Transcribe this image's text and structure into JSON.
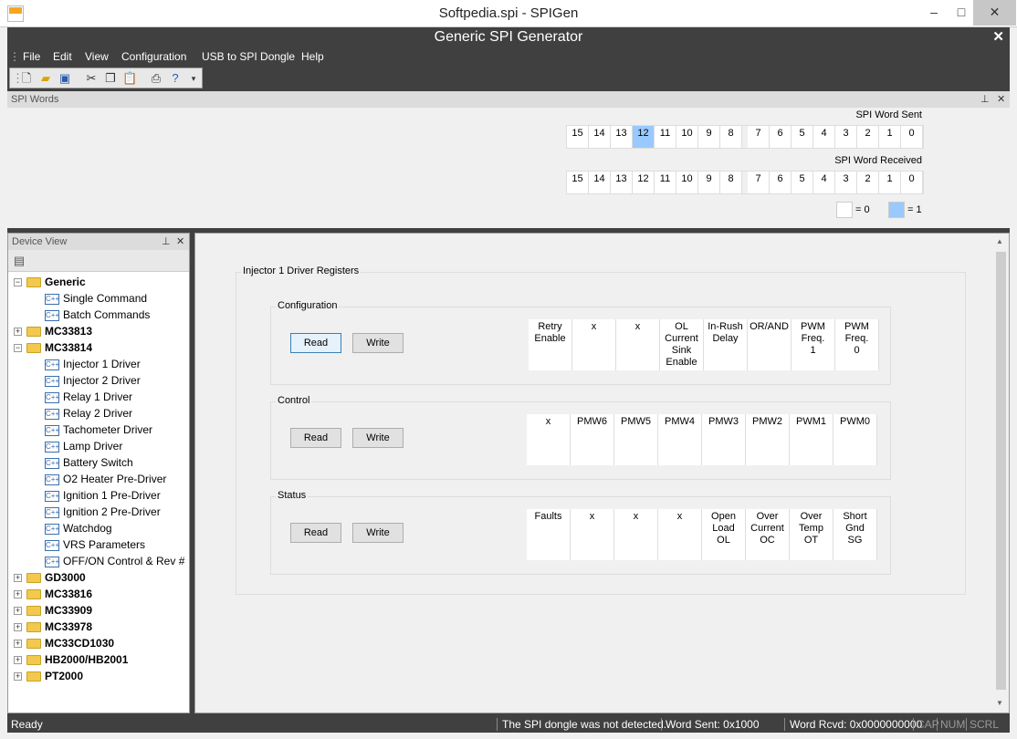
{
  "window": {
    "title": "Softpedia.spi - SPIGen",
    "minimize": "–",
    "maximize": "□",
    "close": "✕"
  },
  "app": {
    "title": "Generic SPI Generator",
    "close": "✕"
  },
  "menu": [
    "File",
    "Edit",
    "View",
    "Configuration",
    "USB to SPI Dongle",
    "Help"
  ],
  "toolbar": [
    "new-icon",
    "open-icon",
    "save-icon",
    "cut-icon",
    "copy-icon",
    "paste-icon",
    "print-icon",
    "help-icon"
  ],
  "spi_panel": {
    "title": "SPI Words",
    "sent_label": "SPI Word Sent",
    "received_label": "SPI Word Received",
    "bits": [
      "15",
      "14",
      "13",
      "12",
      "11",
      "10",
      "9",
      "8",
      "7",
      "6",
      "5",
      "4",
      "3",
      "2",
      "1",
      "0"
    ],
    "sent_on_bits": [
      12
    ],
    "received_on_bits": [],
    "legend_zero": "= 0",
    "legend_one": "= 1",
    "on_color": "#99c9ff"
  },
  "device_view": {
    "title": "Device View",
    "tree": [
      {
        "label": "Generic",
        "level": 0,
        "type": "folder",
        "expanded": true
      },
      {
        "label": "Single Command",
        "level": 1,
        "type": "cmd"
      },
      {
        "label": "Batch Commands",
        "level": 1,
        "type": "cmd"
      },
      {
        "label": "MC33813",
        "level": 0,
        "type": "folder",
        "expanded": false
      },
      {
        "label": "MC33814",
        "level": 0,
        "type": "folder",
        "expanded": true
      },
      {
        "label": "Injector 1 Driver",
        "level": 1,
        "type": "cmd"
      },
      {
        "label": "Injector 2 Driver",
        "level": 1,
        "type": "cmd"
      },
      {
        "label": "Relay 1 Driver",
        "level": 1,
        "type": "cmd"
      },
      {
        "label": "Relay 2 Driver",
        "level": 1,
        "type": "cmd"
      },
      {
        "label": "Tachometer Driver",
        "level": 1,
        "type": "cmd"
      },
      {
        "label": "Lamp Driver",
        "level": 1,
        "type": "cmd"
      },
      {
        "label": "Battery Switch",
        "level": 1,
        "type": "cmd"
      },
      {
        "label": "O2 Heater Pre-Driver",
        "level": 1,
        "type": "cmd"
      },
      {
        "label": "Ignition 1 Pre-Driver",
        "level": 1,
        "type": "cmd"
      },
      {
        "label": "Ignition 2 Pre-Driver",
        "level": 1,
        "type": "cmd"
      },
      {
        "label": "Watchdog",
        "level": 1,
        "type": "cmd"
      },
      {
        "label": "VRS Parameters",
        "level": 1,
        "type": "cmd"
      },
      {
        "label": "OFF/ON Control & Rev #",
        "level": 1,
        "type": "cmd"
      },
      {
        "label": "GD3000",
        "level": 0,
        "type": "folder",
        "expanded": false
      },
      {
        "label": "MC33816",
        "level": 0,
        "type": "folder",
        "expanded": false
      },
      {
        "label": "MC33909",
        "level": 0,
        "type": "folder",
        "expanded": false
      },
      {
        "label": "MC33978",
        "level": 0,
        "type": "folder",
        "expanded": false
      },
      {
        "label": "MC33CD1030",
        "level": 0,
        "type": "folder",
        "expanded": false
      },
      {
        "label": "HB2000/HB2001",
        "level": 0,
        "type": "folder",
        "expanded": false
      },
      {
        "label": "PT2000",
        "level": 0,
        "type": "folder",
        "expanded": false
      }
    ]
  },
  "registers": {
    "title": "Injector 1 Driver Registers",
    "groups": [
      {
        "title": "Configuration",
        "read": "Read",
        "write": "Write",
        "cells": [
          "Retry\nEnable",
          "x",
          "x",
          "OL\nCurrent\nSink\nEnable",
          "In-Rush\nDelay",
          "OR/AND",
          "PWM\nFreq.\n1",
          "PWM\nFreq.\n0"
        ]
      },
      {
        "title": "Control",
        "read": "Read",
        "write": "Write",
        "cells": [
          "x",
          "PMW6",
          "PMW5",
          "PMW4",
          "PMW3",
          "PMW2",
          "PWM1",
          "PWM0"
        ]
      },
      {
        "title": "Status",
        "read": "Read",
        "write": "Write",
        "cells": [
          "Faults",
          "x",
          "x",
          "x",
          "Open\nLoad\nOL",
          "Over\nCurrent\nOC",
          "Over\nTemp\nOT",
          "Short\nGnd\nSG"
        ]
      }
    ]
  },
  "status": {
    "ready": "Ready",
    "dongle": "The SPI dongle was not detected.",
    "sent": "Word Sent: 0x1000",
    "received": "Word Rcvd: 0x0000000000",
    "caps": "CAP",
    "num": "NUM",
    "scrl": "SCRL"
  }
}
